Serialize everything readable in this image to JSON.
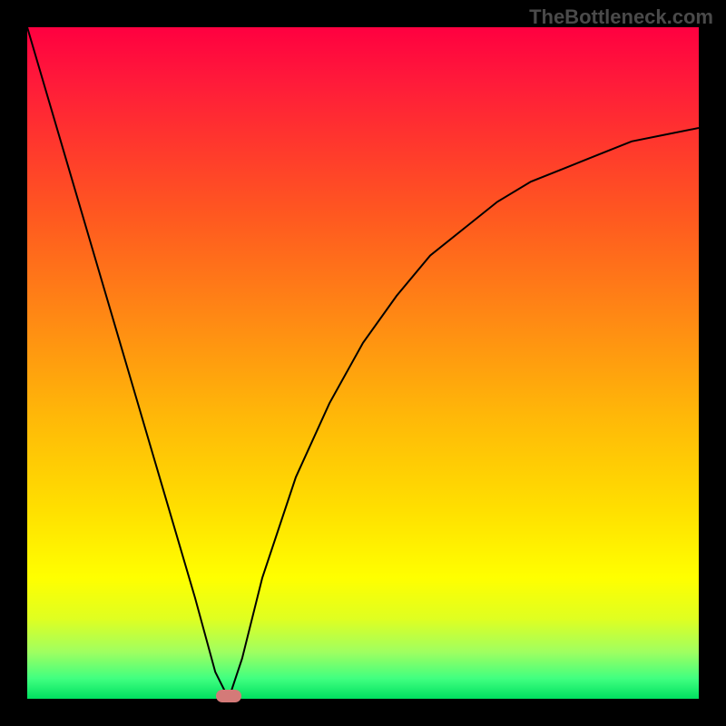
{
  "watermark": "TheBottleneck.com",
  "chart_data": {
    "type": "line",
    "title": "",
    "xlabel": "",
    "ylabel": "",
    "xlim": [
      0,
      100
    ],
    "ylim": [
      0,
      100
    ],
    "legend": false,
    "gradient_background": {
      "top": "#ff0040",
      "mid": "#ffe000",
      "bottom": "#00e060"
    },
    "series": [
      {
        "name": "left-branch",
        "x": [
          0,
          5,
          10,
          15,
          20,
          25,
          28,
          30
        ],
        "y": [
          100,
          83,
          66,
          49,
          32,
          15,
          4,
          0
        ]
      },
      {
        "name": "right-branch",
        "x": [
          30,
          32,
          35,
          40,
          45,
          50,
          55,
          60,
          65,
          70,
          75,
          80,
          85,
          90,
          95,
          100
        ],
        "y": [
          0,
          6,
          18,
          33,
          44,
          53,
          60,
          66,
          70,
          74,
          77,
          79,
          81,
          83,
          84,
          85
        ]
      }
    ],
    "marker": {
      "name": "optimal-point",
      "x": 30,
      "y": 0,
      "color": "#d47a78"
    }
  }
}
